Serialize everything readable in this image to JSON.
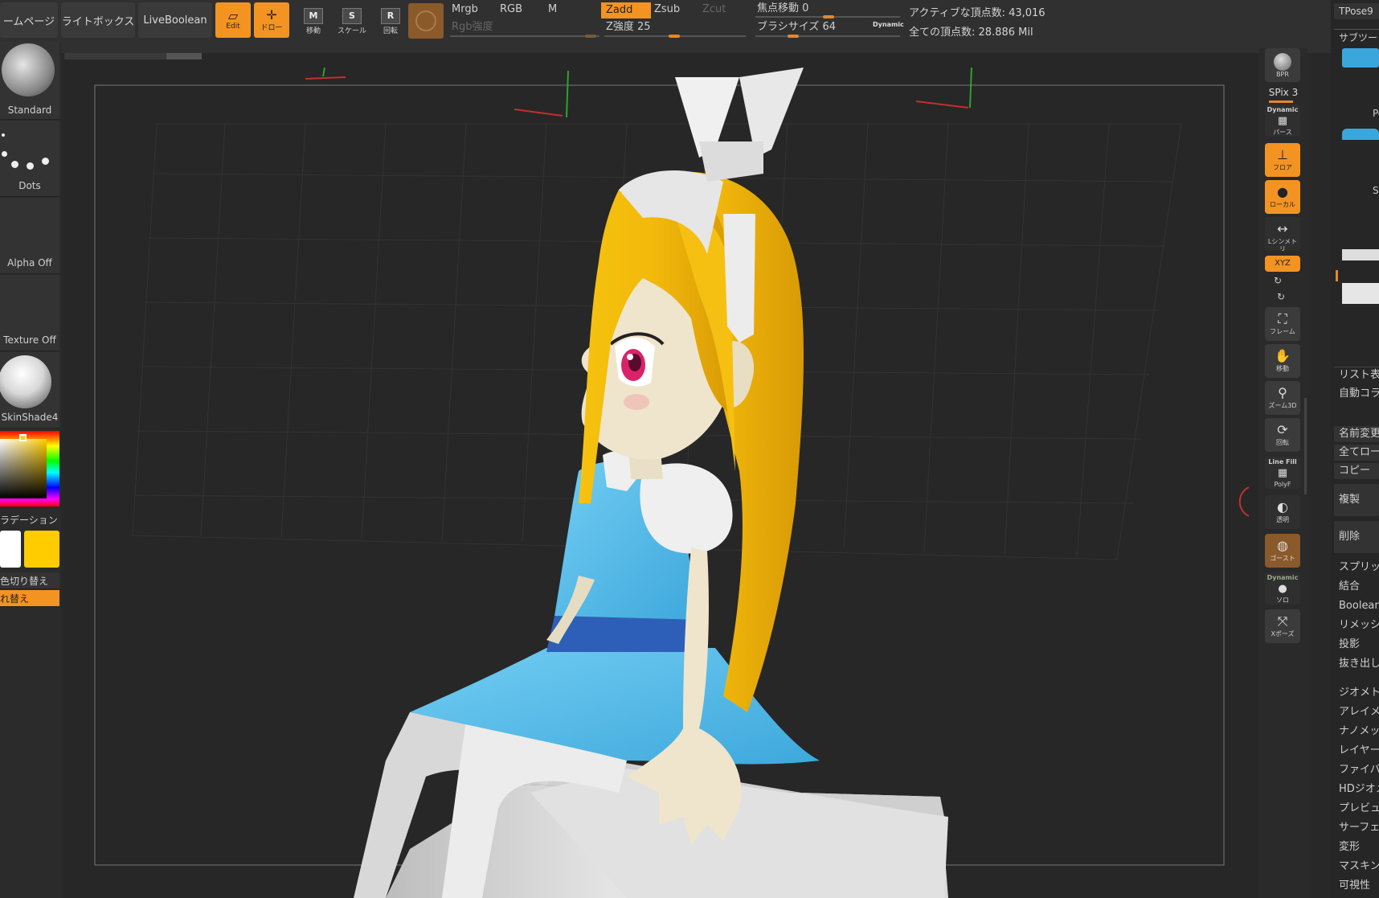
{
  "topbar": {
    "home_label": "ームページ",
    "lightbox_label": "ライトボックス",
    "liveboolean_label": "LiveBoolean",
    "edit_label": "Edit",
    "draw_label": "ドロー",
    "move_label": "移動",
    "scale_label": "スケール",
    "rotate_label": "回転",
    "move_key": "M",
    "scale_key": "S",
    "rotate_key": "R",
    "modes": {
      "mrgb": "Mrgb",
      "rgb": "RGB",
      "m": "M",
      "zadd": "Zadd",
      "zsub": "Zsub",
      "zcut": "Zcut",
      "rgb_intensity": "Rgb強度",
      "z_intensity": "Z強度 25"
    },
    "focal_shift": "焦点移動 0",
    "brush_size": "ブラシサイズ 64",
    "dynamic": "Dynamic",
    "active_points": "アクティブな頂点数: 43,016",
    "total_points": "全ての頂点数: 28.886 Mil"
  },
  "lefttray": {
    "brush": "Standard",
    "stroke": "Dots",
    "alpha": "Alpha Off",
    "texture": "Texture Off",
    "material": "SkinShade4",
    "gradient": "ラデーション",
    "switch_color": "色切り替え",
    "alternate": "れ替え",
    "main_color": "#ffffff",
    "secondary_color": "#ffcc00"
  },
  "rshelf": {
    "bpr": "BPR",
    "spix": "SPix 3",
    "dynamic": "Dynamic",
    "persp": "パース",
    "floor": "フロア",
    "local": "ローカル",
    "symmetry": "Lシンメトリ",
    "xyz": "XYZ",
    "frame": "フレーム",
    "move": "移動",
    "zoom3d": "ズーム3D",
    "rotate": "回転",
    "line_fill": "Line Fill",
    "polyf": "PolyF",
    "transp": "透明",
    "ghost": "ゴースト",
    "dynamic2": "Dynamic",
    "solo": "ソロ",
    "xpose": "Xポーズ"
  },
  "rpanel": {
    "tool_name": "TPose9",
    "subtool": "サブツー",
    "pol": "Po",
    "sk": "Sk",
    "list": "リスト表",
    "autocollapse": "自動コラ",
    "rename": "名前変更",
    "allload": "全てロー",
    "copy": "コピー",
    "duplicate": "複製",
    "delete": "削除",
    "split": "スプリッ",
    "merge": "結合",
    "boolean": "Boolean",
    "remesh": "リメッシ",
    "project": "投影",
    "extract": "抜き出し",
    "geometry": "ジオメト",
    "array": "アレイメ",
    "nanomesh": "ナノメッ",
    "layers": "レイヤー",
    "fibermesh": "ファイバ",
    "hdgeo": "HDジオメ",
    "preview": "プレビュ",
    "surface": "サーフェ",
    "deform": "変形",
    "masking": "マスキン",
    "visibility": "可視性"
  },
  "colors": {
    "accent": "#f39322",
    "hair": "#f2b90b",
    "dress": "#4fb8e8",
    "belt": "#2e5fb8",
    "skin": "#efe5cc",
    "white_parts": "#e6e6e6"
  }
}
